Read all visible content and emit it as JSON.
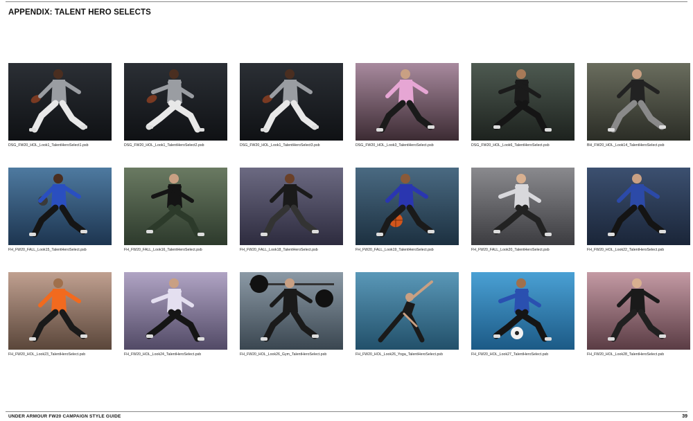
{
  "page": {
    "title": "APPENDIX: TALENT HERO SELECTS",
    "footer_left": "UNDER ARMOUR FW20 CAMPAIGN STYLE GUIDE",
    "page_number": "39"
  },
  "tiles": [
    {
      "caption": "DSG_FW20_HOL_Look1_TalentHeroSelect1.psb",
      "bg_top": "#2b2f35",
      "bg_bottom": "#0f1114",
      "top_color": "#9a9da2",
      "bottom_color": "#e8e8e8",
      "skin": "#4a2e20",
      "prop": "football"
    },
    {
      "caption": "DSG_FW20_HOL_Look1_TalentHeroSelect2.psb",
      "bg_top": "#2b2f35",
      "bg_bottom": "#0f1114",
      "top_color": "#9a9da2",
      "bottom_color": "#e8e8e8",
      "skin": "#4a2e20",
      "prop": "football"
    },
    {
      "caption": "DSG_FW20_HOL_Look1_TalentHeroSelect3.psb",
      "bg_top": "#2b2f35",
      "bg_bottom": "#0f1114",
      "top_color": "#9a9da2",
      "bottom_color": "#e8e8e8",
      "skin": "#4a2e20",
      "prop": "football"
    },
    {
      "caption": "DSG_FW20_HOL_Look3_TalentHeroSelect.psb",
      "bg_top": "#a88a9e",
      "bg_bottom": "#3c2b33",
      "top_color": "#e6a6d4",
      "bottom_color": "#1a1a1a",
      "skin": "#c9a083",
      "prop": "none"
    },
    {
      "caption": "DSG_FW20_HOL_Look6_TalentHeroSelect.psb",
      "bg_top": "#4e5a51",
      "bg_bottom": "#1d221e",
      "top_color": "#1b1b1b",
      "bottom_color": "#151515",
      "skin": "#a77a58",
      "prop": "none"
    },
    {
      "caption": "BH_FW20_HOL_Look14_TalentHeroSelect.psb",
      "bg_top": "#6a6d5e",
      "bg_bottom": "#2b2d26",
      "top_color": "#222",
      "bottom_color": "#8a8a8a",
      "skin": "#c9a083",
      "prop": "none"
    },
    {
      "caption": "FH_FW20_FALL_Look15_TalentHeroSelect.psb",
      "bg_top": "#4e7aa0",
      "bg_bottom": "#1d3550",
      "top_color": "#2a4fc0",
      "bottom_color": "#151515",
      "skin": "#4a2e20",
      "prop": "ball-dark"
    },
    {
      "caption": "FH_FW20_FALL_Look16_TalentHeroSelect.psb",
      "bg_top": "#6a7a62",
      "bg_bottom": "#2d3a2c",
      "top_color": "#141414",
      "bottom_color": "#2c3a2a",
      "skin": "#c9a083",
      "prop": "none"
    },
    {
      "caption": "FH_FW20_FALL_Look18_TalentHeroSelect.psb",
      "bg_top": "#6c6a82",
      "bg_bottom": "#2d2b3e",
      "top_color": "#1a1a1a",
      "bottom_color": "#333",
      "skin": "#6a4028",
      "prop": "none"
    },
    {
      "caption": "FH_FW20_FALL_Look19_TalentHeroSelect.psb",
      "bg_top": "#4a6a82",
      "bg_bottom": "#1c3040",
      "top_color": "#2a36b0",
      "bottom_color": "#1a1a1a",
      "skin": "#8a5a3a",
      "prop": "ball-orange"
    },
    {
      "caption": "FH_FW20_FALL_Look20_TalentHeroSelect.psb",
      "bg_top": "#8a8a8e",
      "bg_bottom": "#3c3c40",
      "top_color": "#d8d8dc",
      "bottom_color": "#222",
      "skin": "#d8b090",
      "prop": "none"
    },
    {
      "caption": "FH_FW20_HOL_Look22_TalentHeroSelect.psb",
      "bg_top": "#3c5070",
      "bg_bottom": "#1a2538",
      "top_color": "#2c4aa8",
      "bottom_color": "#141414",
      "skin": "#c9a083",
      "prop": "none"
    },
    {
      "caption": "FH_FW20_HOL_Look23_TalentHeroSelect.psb",
      "bg_top": "#c0a090",
      "bg_bottom": "#5a463a",
      "top_color": "#f26a1e",
      "bottom_color": "#1a1a1a",
      "skin": "#a0704c",
      "prop": "none"
    },
    {
      "caption": "FH_FW20_HOL_Look24_TalentHeroSelect.psb",
      "bg_top": "#b0a4c4",
      "bg_bottom": "#524a66",
      "top_color": "#e4dff0",
      "bottom_color": "#151515",
      "skin": "#c9a083",
      "prop": "none"
    },
    {
      "caption": "FH_FW20_HOL_Look26_Gym_TalentHeroSelect.psb",
      "bg_top": "#8c9aa6",
      "bg_bottom": "#3a4650",
      "top_color": "#1a1a1a",
      "bottom_color": "#1a1a1a",
      "skin": "#c9a083",
      "prop": "barbell"
    },
    {
      "caption": "FH_FW20_HOL_Look26_Yoga_TalentHeroSelect.psb",
      "bg_top": "#5a98b8",
      "bg_bottom": "#22506a",
      "top_color": "#1a1a1a",
      "bottom_color": "#1a1a1a",
      "skin": "#c9a083",
      "prop": "yoga"
    },
    {
      "caption": "FH_FW20_HOL_Look27_TalentHeroSelect.psb",
      "bg_top": "#4aa0d4",
      "bg_bottom": "#1c5a86",
      "top_color": "#2a50b0",
      "bottom_color": "#151515",
      "skin": "#a0704c",
      "prop": "soccer"
    },
    {
      "caption": "FH_FW20_HOL_Look28_TalentHeroSelect.psb",
      "bg_top": "#c49aa4",
      "bg_bottom": "#5a3c44",
      "top_color": "#1a1a1a",
      "bottom_color": "#202020",
      "skin": "#d8b090",
      "prop": "none"
    }
  ]
}
